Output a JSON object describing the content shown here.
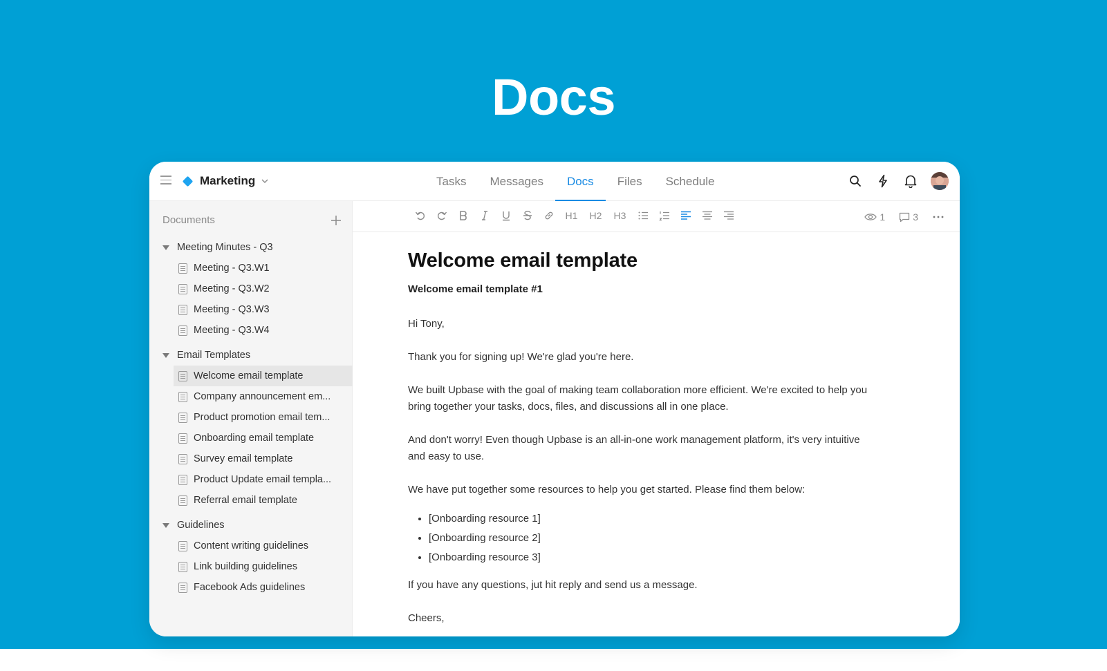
{
  "hero": {
    "title": "Docs"
  },
  "header": {
    "project": "Marketing",
    "tabs": [
      {
        "label": "Tasks",
        "active": false
      },
      {
        "label": "Messages",
        "active": false
      },
      {
        "label": "Docs",
        "active": true
      },
      {
        "label": "Files",
        "active": false
      },
      {
        "label": "Schedule",
        "active": false
      }
    ],
    "icons": [
      "search-icon",
      "bolt-icon",
      "bell-icon",
      "avatar"
    ]
  },
  "sidebar": {
    "title": "Documents",
    "groups": [
      {
        "label": "Meeting Minutes - Q3",
        "items": [
          "Meeting - Q3.W1",
          "Meeting - Q3.W2",
          "Meeting - Q3.W3",
          "Meeting - Q3.W4"
        ]
      },
      {
        "label": "Email Templates",
        "items": [
          "Welcome email template",
          "Company announcement em...",
          "Product promotion email tem...",
          "Onboarding email template",
          "Survey email template",
          "Product Update email templa...",
          "Referral email template"
        ]
      },
      {
        "label": "Guidelines",
        "items": [
          "Content writing guidelines",
          "Link building guidelines",
          "Facebook Ads guidelines"
        ]
      }
    ]
  },
  "toolbar": {
    "h1": "H1",
    "h2": "H2",
    "h3": "H3",
    "views": "1",
    "comments": "3"
  },
  "document": {
    "title": "Welcome email template",
    "subtitle": "Welcome email template #1",
    "greeting": "Hi Tony,",
    "p1": "Thank you for signing up! We're glad you're here.",
    "p2": "We built Upbase with the goal of making team collaboration more efficient. We're excited to help you bring together your tasks, docs, files, and discussions all in one place.",
    "p3": "And don't worry! Even though Upbase is an all-in-one work management platform, it's very intuitive and easy to use.",
    "p4": "We have put together some resources to help you get started. Please find them below:",
    "bullets": [
      "[Onboarding resource 1]",
      "[Onboarding resource 2]",
      "[Onboarding resource 3]"
    ],
    "p5": "If you have any questions, jut hit reply and send us a message.",
    "closing": "Cheers,"
  },
  "colors": {
    "hero_bg": "#00a0d5",
    "accent": "#1a8be3",
    "brand_diamond": "#1ea4f0"
  }
}
